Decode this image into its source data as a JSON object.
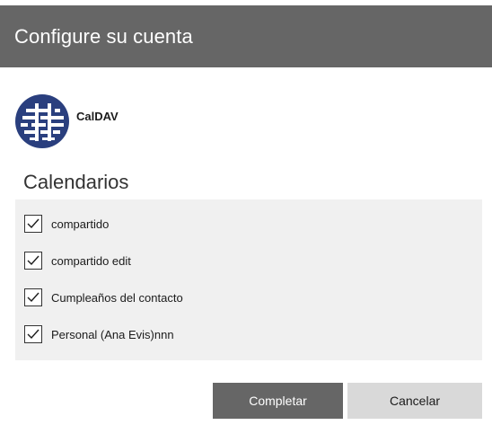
{
  "dialog": {
    "title": "Configure su cuenta"
  },
  "account": {
    "name": "CalDAV",
    "logo_icon": "caldav-globe-icon",
    "logo_color": "#2a3f7e"
  },
  "calendars": {
    "heading": "Calendarios",
    "items": [
      {
        "label": "compartido",
        "checked": true
      },
      {
        "label": "compartido edit",
        "checked": true
      },
      {
        "label": "Cumpleaños del contacto",
        "checked": true
      },
      {
        "label": "Personal (Ana Evis)nnn",
        "checked": true
      }
    ]
  },
  "buttons": {
    "complete_label": "Completar",
    "cancel_label": "Cancelar"
  },
  "colors": {
    "titlebar": "#666666",
    "primary_button": "#666666",
    "secondary_button": "#d9d9d9",
    "panel": "#f0f0f0"
  }
}
